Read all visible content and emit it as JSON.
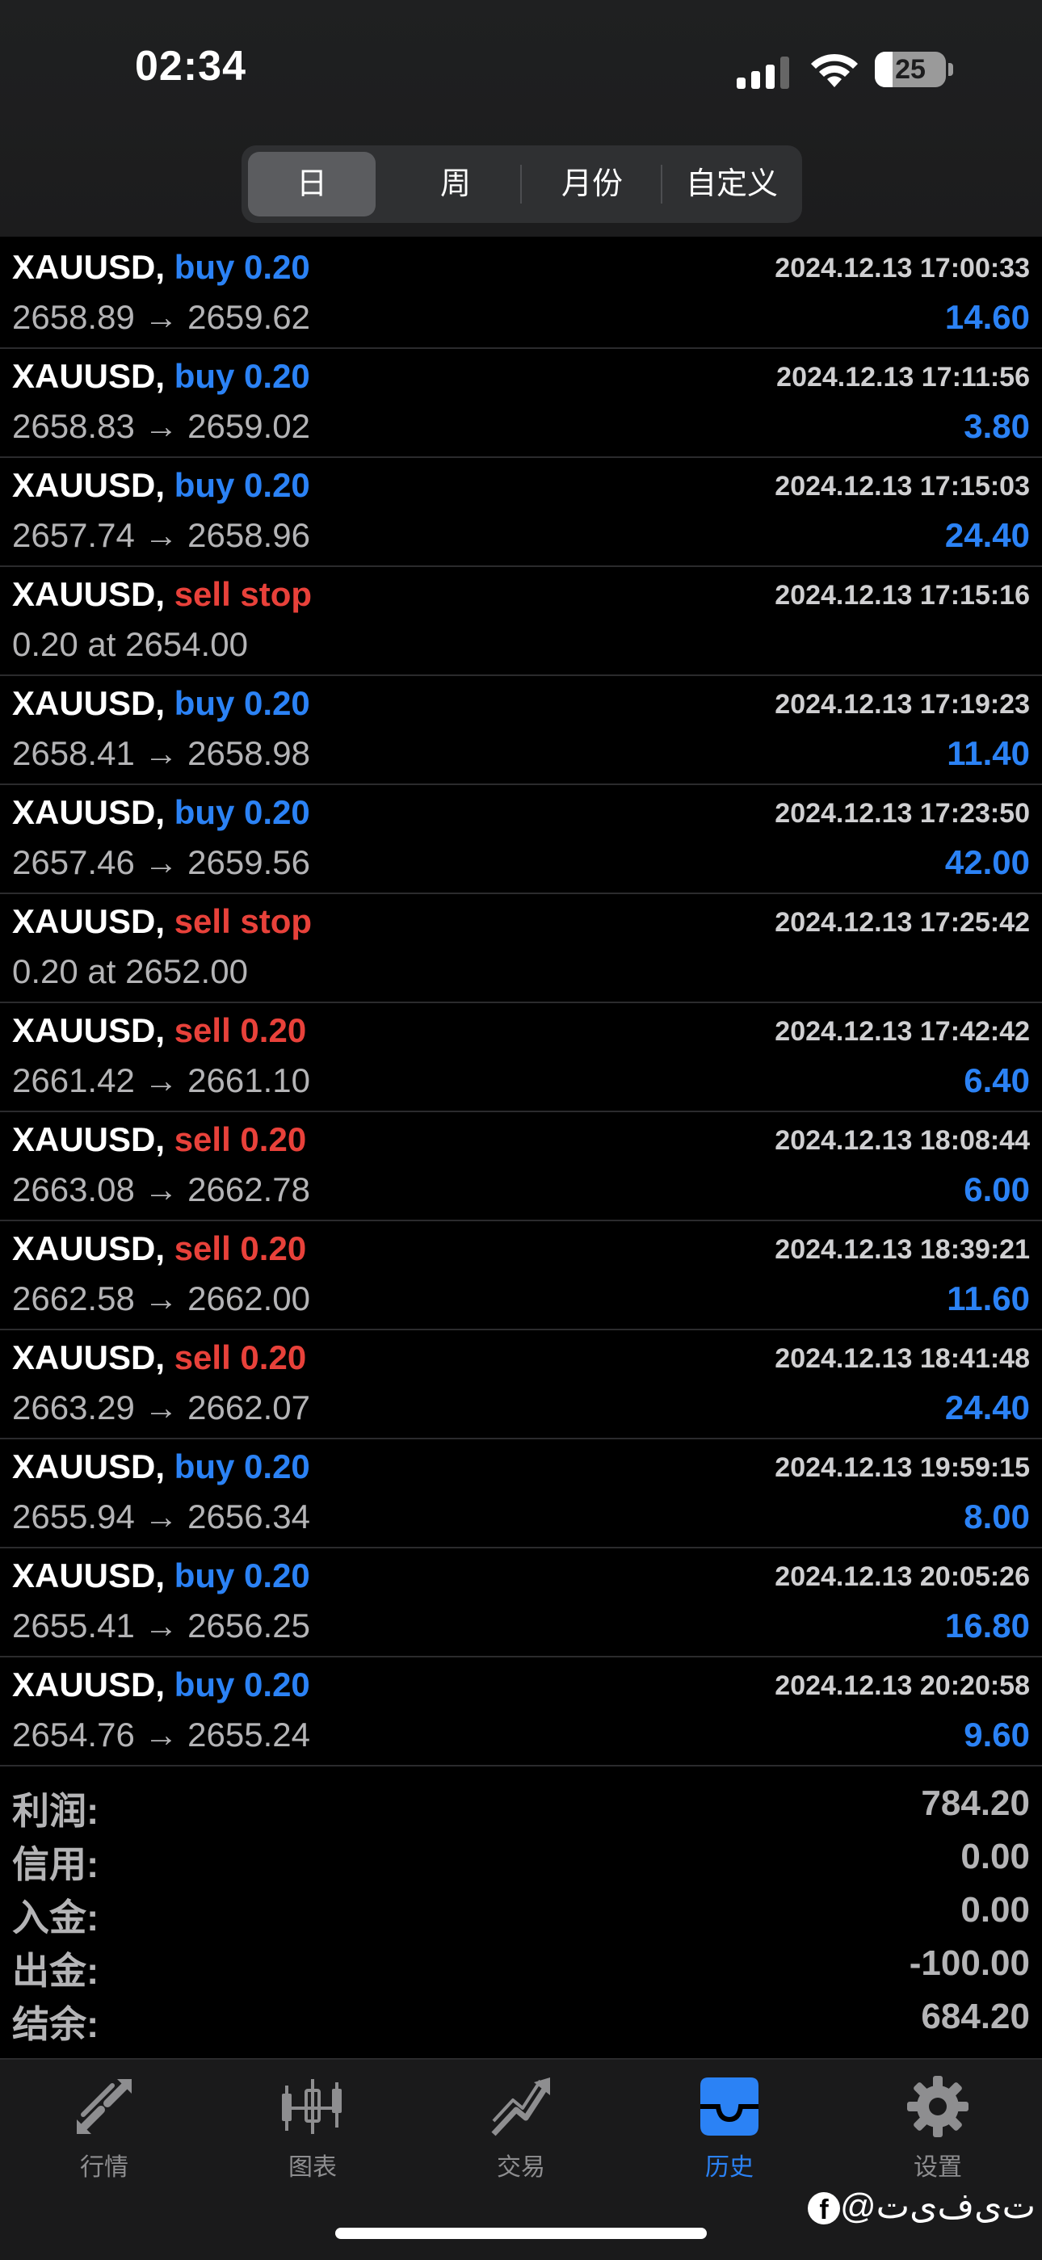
{
  "status_bar": {
    "time": "02:34",
    "battery": "25"
  },
  "segments": [
    {
      "label": "日",
      "active": true
    },
    {
      "label": "周",
      "active": false
    },
    {
      "label": "月份",
      "active": false
    },
    {
      "label": "自定义",
      "active": false
    }
  ],
  "rows": [
    {
      "symbol": "XAUUSD,",
      "action": "buy 0.20",
      "side": "buy",
      "timestamp": "2024.12.13 17:00:33",
      "prices": "2658.89 → 2659.62",
      "profit": "14.60"
    },
    {
      "symbol": "XAUUSD,",
      "action": "buy 0.20",
      "side": "buy",
      "timestamp": "2024.12.13 17:11:56",
      "prices": "2658.83 → 2659.02",
      "profit": "3.80"
    },
    {
      "symbol": "XAUUSD,",
      "action": "buy 0.20",
      "side": "buy",
      "timestamp": "2024.12.13 17:15:03",
      "prices": "2657.74 → 2658.96",
      "profit": "24.40"
    },
    {
      "symbol": "XAUUSD,",
      "action": "sell stop",
      "side": "sell",
      "timestamp": "2024.12.13 17:15:16",
      "prices": "0.20 at 2654.00",
      "profit": ""
    },
    {
      "symbol": "XAUUSD,",
      "action": "buy 0.20",
      "side": "buy",
      "timestamp": "2024.12.13 17:19:23",
      "prices": "2658.41 → 2658.98",
      "profit": "11.40"
    },
    {
      "symbol": "XAUUSD,",
      "action": "buy 0.20",
      "side": "buy",
      "timestamp": "2024.12.13 17:23:50",
      "prices": "2657.46 → 2659.56",
      "profit": "42.00"
    },
    {
      "symbol": "XAUUSD,",
      "action": "sell stop",
      "side": "sell",
      "timestamp": "2024.12.13 17:25:42",
      "prices": "0.20 at 2652.00",
      "profit": ""
    },
    {
      "symbol": "XAUUSD,",
      "action": "sell 0.20",
      "side": "sell",
      "timestamp": "2024.12.13 17:42:42",
      "prices": "2661.42 → 2661.10",
      "profit": "6.40"
    },
    {
      "symbol": "XAUUSD,",
      "action": "sell 0.20",
      "side": "sell",
      "timestamp": "2024.12.13 18:08:44",
      "prices": "2663.08 → 2662.78",
      "profit": "6.00"
    },
    {
      "symbol": "XAUUSD,",
      "action": "sell 0.20",
      "side": "sell",
      "timestamp": "2024.12.13 18:39:21",
      "prices": "2662.58 → 2662.00",
      "profit": "11.60"
    },
    {
      "symbol": "XAUUSD,",
      "action": "sell 0.20",
      "side": "sell",
      "timestamp": "2024.12.13 18:41:48",
      "prices": "2663.29 → 2662.07",
      "profit": "24.40"
    },
    {
      "symbol": "XAUUSD,",
      "action": "buy 0.20",
      "side": "buy",
      "timestamp": "2024.12.13 19:59:15",
      "prices": "2655.94 → 2656.34",
      "profit": "8.00"
    },
    {
      "symbol": "XAUUSD,",
      "action": "buy 0.20",
      "side": "buy",
      "timestamp": "2024.12.13 20:05:26",
      "prices": "2655.41 → 2656.25",
      "profit": "16.80"
    },
    {
      "symbol": "XAUUSD,",
      "action": "buy 0.20",
      "side": "buy",
      "timestamp": "2024.12.13 20:20:58",
      "prices": "2654.76 → 2655.24",
      "profit": "9.60"
    }
  ],
  "summary": [
    {
      "label": "利润:",
      "value": "784.20"
    },
    {
      "label": "信用:",
      "value": "0.00"
    },
    {
      "label": "入金:",
      "value": "0.00"
    },
    {
      "label": "出金:",
      "value": "-100.00"
    },
    {
      "label": "结余:",
      "value": "684.20"
    }
  ],
  "tabs": [
    {
      "label": "行情",
      "icon": "quotes-arrows-icon",
      "active": false
    },
    {
      "label": "图表",
      "icon": "candlestick-chart-icon",
      "active": false
    },
    {
      "label": "交易",
      "icon": "trade-trend-icon",
      "active": false
    },
    {
      "label": "历史",
      "icon": "history-inbox-icon",
      "active": true
    },
    {
      "label": "设置",
      "icon": "gear-icon",
      "active": false
    }
  ],
  "watermark": "@ت‌ی‌ف‌ی‌ت",
  "colors": {
    "buy": "#2b82f5",
    "sell": "#e8413a",
    "accent": "#2b82f5",
    "muted": "#b4b4b6"
  }
}
